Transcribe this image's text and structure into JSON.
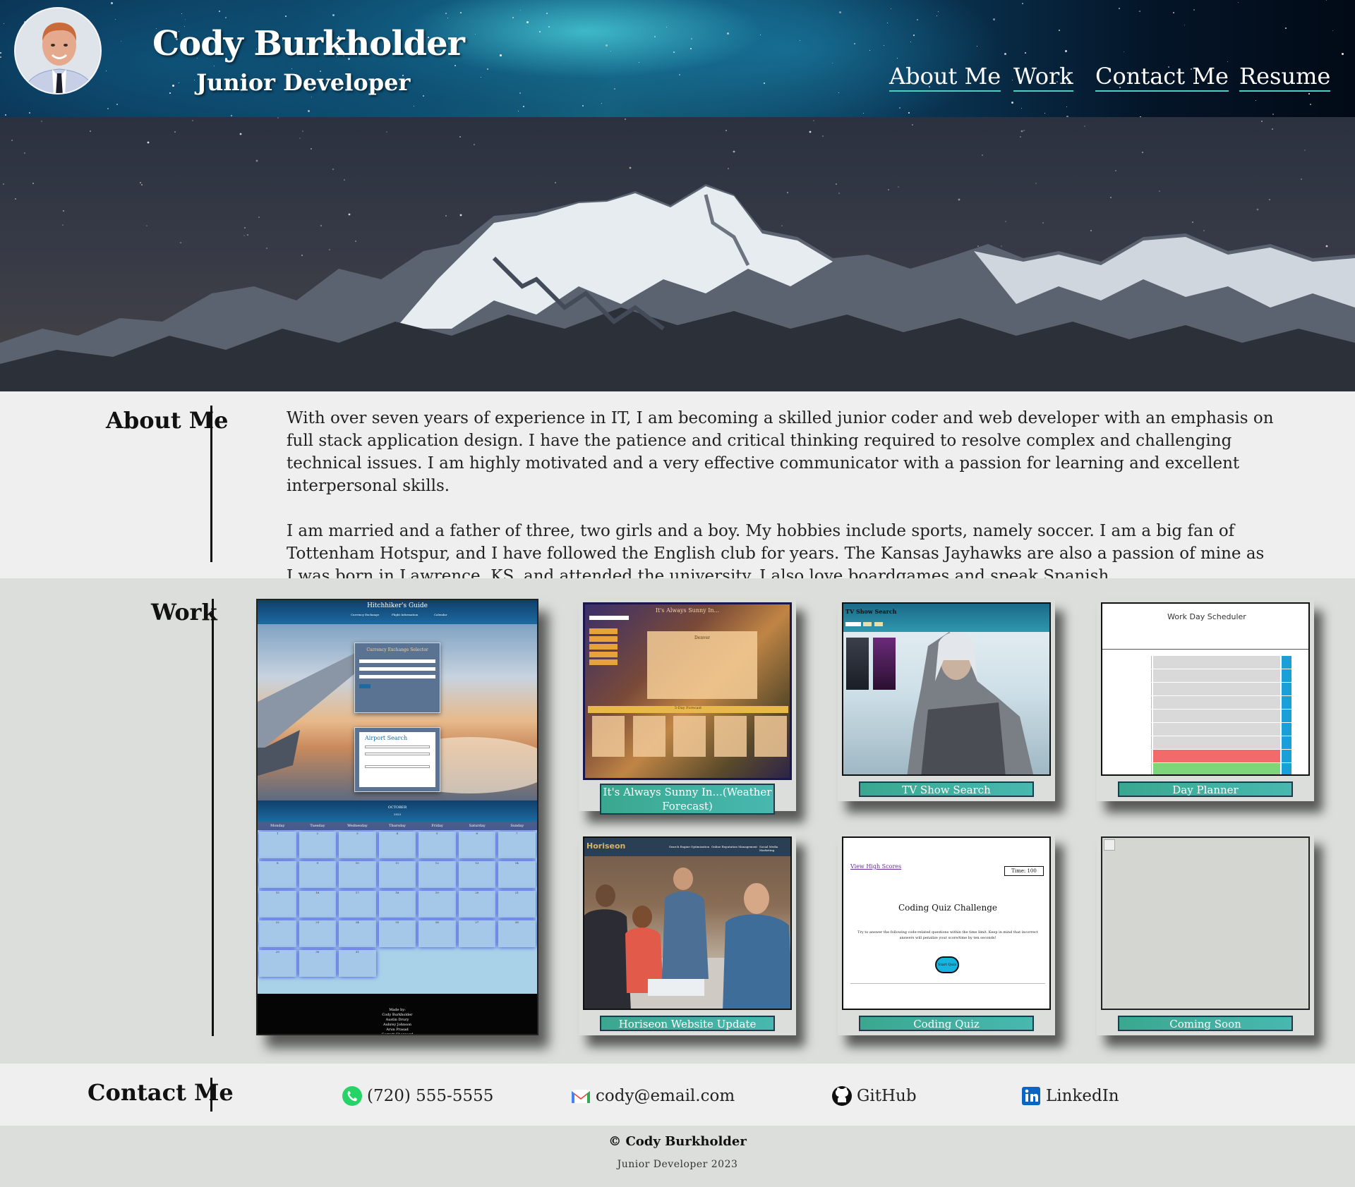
{
  "header": {
    "name": "Cody Burkholder",
    "subtitle": "Junior Developer",
    "nav": [
      {
        "label": "About Me"
      },
      {
        "label": "Work"
      },
      {
        "label": "Contact Me"
      },
      {
        "label": "Resume"
      }
    ]
  },
  "about": {
    "title": "About Me",
    "paragraphs": [
      "With over seven years of experience in IT, I am becoming a skilled junior coder and web developer with an emphasis on full stack application design. I have the patience and critical thinking required to resolve complex and challenging technical issues. I am highly motivated and a very effective communicator with a passion for learning and excellent interpersonal skills.",
      "I am married and a father of three, two girls and a boy. My hobbies include sports, namely soccer. I am a big fan of Tottenham Hotspur, and I have followed the English club for years. The Kansas Jayhawks are also a passion of mine as I was born in Lawrence, KS, and attended the university. I also love boardgames and speak Spanish."
    ]
  },
  "work": {
    "title": "Work",
    "featured": {
      "title": "Hitchhiker's Guide",
      "nav": [
        "Currency Exchange",
        "Flight Information",
        "Calendar"
      ],
      "currency_heading": "Currency Exchange Selector",
      "airport_heading": "Airport Search",
      "calendar_month": "OCTOBER",
      "calendar_year": "2023",
      "weekdays": [
        "Monday",
        "Tuesday",
        "Wednesday",
        "Thursday",
        "Friday",
        "Saturday",
        "Sunday"
      ],
      "footer_lines": [
        "Made by:",
        "Cody Burkholder",
        "Austin Drury",
        "Aubrey Johnson",
        "Arun Prasad",
        "Garrett Sheppard"
      ]
    },
    "projects": [
      {
        "label": "It's Always Sunny In...(Weather Forecast)",
        "shot_title": "It's Always Sunny In...",
        "shot_panel": "Denver",
        "shot_bar": "5-Day Forecast"
      },
      {
        "label": "TV Show Search",
        "shot_title": "TV Show Search"
      },
      {
        "label": "Day Planner",
        "shot_title": "Work Day Scheduler"
      },
      {
        "label": "Horiseon Website Update",
        "shot_title": "Horiseon",
        "shot_nav": [
          "Search Engine Optimization",
          "Online Reputation Management",
          "Social Media Marketing"
        ]
      },
      {
        "label": "Coding Quiz",
        "shot_title": "Coding Quiz Challenge",
        "shot_link": "View High Scores",
        "shot_timer": "Time: 100",
        "shot_button": "Start Quiz",
        "shot_text": "Try to answer the following code-related questions within the time limit. Keep in mind that incorrect answers will penalize your score/time by ten seconds!"
      },
      {
        "label": "Coming Soon"
      }
    ]
  },
  "contact": {
    "title": "Contact Me",
    "phone": "(720) 555-5555",
    "email": "cody@email.com",
    "github": "GitHub",
    "linkedin": "LinkedIn"
  },
  "footer": {
    "copyright": "© Cody Burkholder",
    "tagline": "Junior Developer 2023"
  },
  "colors": {
    "accent": "#4dd0c4",
    "label_bg": "#3aa88f",
    "section_light": "#efefef",
    "section_dark": "#dcdedb"
  }
}
